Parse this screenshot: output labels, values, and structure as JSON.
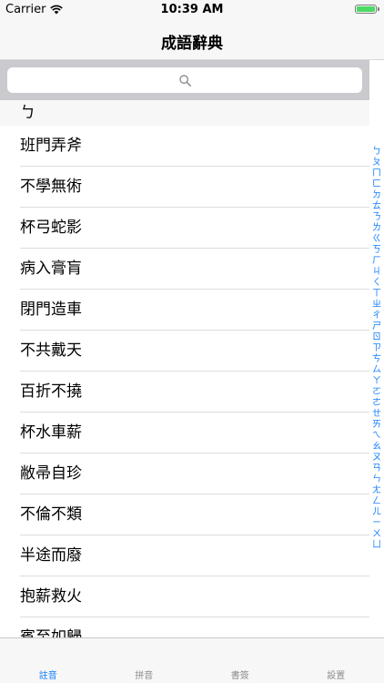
{
  "status": {
    "carrier": "Carrier",
    "time": "10:39 AM",
    "battery_color": "#4cd964"
  },
  "nav": {
    "title": "成語辭典"
  },
  "search": {
    "placeholder": ""
  },
  "section": {
    "title": "ㄅ"
  },
  "rows": [
    "班門弄斧",
    "不學無術",
    "杯弓蛇影",
    "病入膏肓",
    "閉門造車",
    "不共戴天",
    "百折不撓",
    "杯水車薪",
    "敝帚自珍",
    "不倫不類",
    "半途而廢",
    "抱薪救火",
    "賓至如歸"
  ],
  "index": [
    "ㄅ",
    "ㄆ",
    "ㄇ",
    "ㄈ",
    "ㄉ",
    "ㄊ",
    "ㄋ",
    "ㄌ",
    "ㄍ",
    "ㄎ",
    "ㄏ",
    "ㄐ",
    "ㄑ",
    "ㄒ",
    "ㄓ",
    "ㄔ",
    "ㄕ",
    "ㄖ",
    "ㄗ",
    "ㄘ",
    "ㄙ",
    "ㄚ",
    "ㄛ",
    "ㄜ",
    "ㄝ",
    "ㄞ",
    "ㄟ",
    "ㄠ",
    "ㄡ",
    "ㄢ",
    "ㄣ",
    "ㄤ",
    "ㄥ",
    "ㄦ",
    "ㄧ",
    "ㄨ",
    "ㄩ"
  ],
  "tabs": [
    {
      "label": "註音",
      "active": true
    },
    {
      "label": "拼音",
      "active": false
    },
    {
      "label": "書簽",
      "active": false
    },
    {
      "label": "設置",
      "active": false
    }
  ],
  "colors": {
    "accent": "#147efb",
    "inactive": "#8e8e93"
  }
}
